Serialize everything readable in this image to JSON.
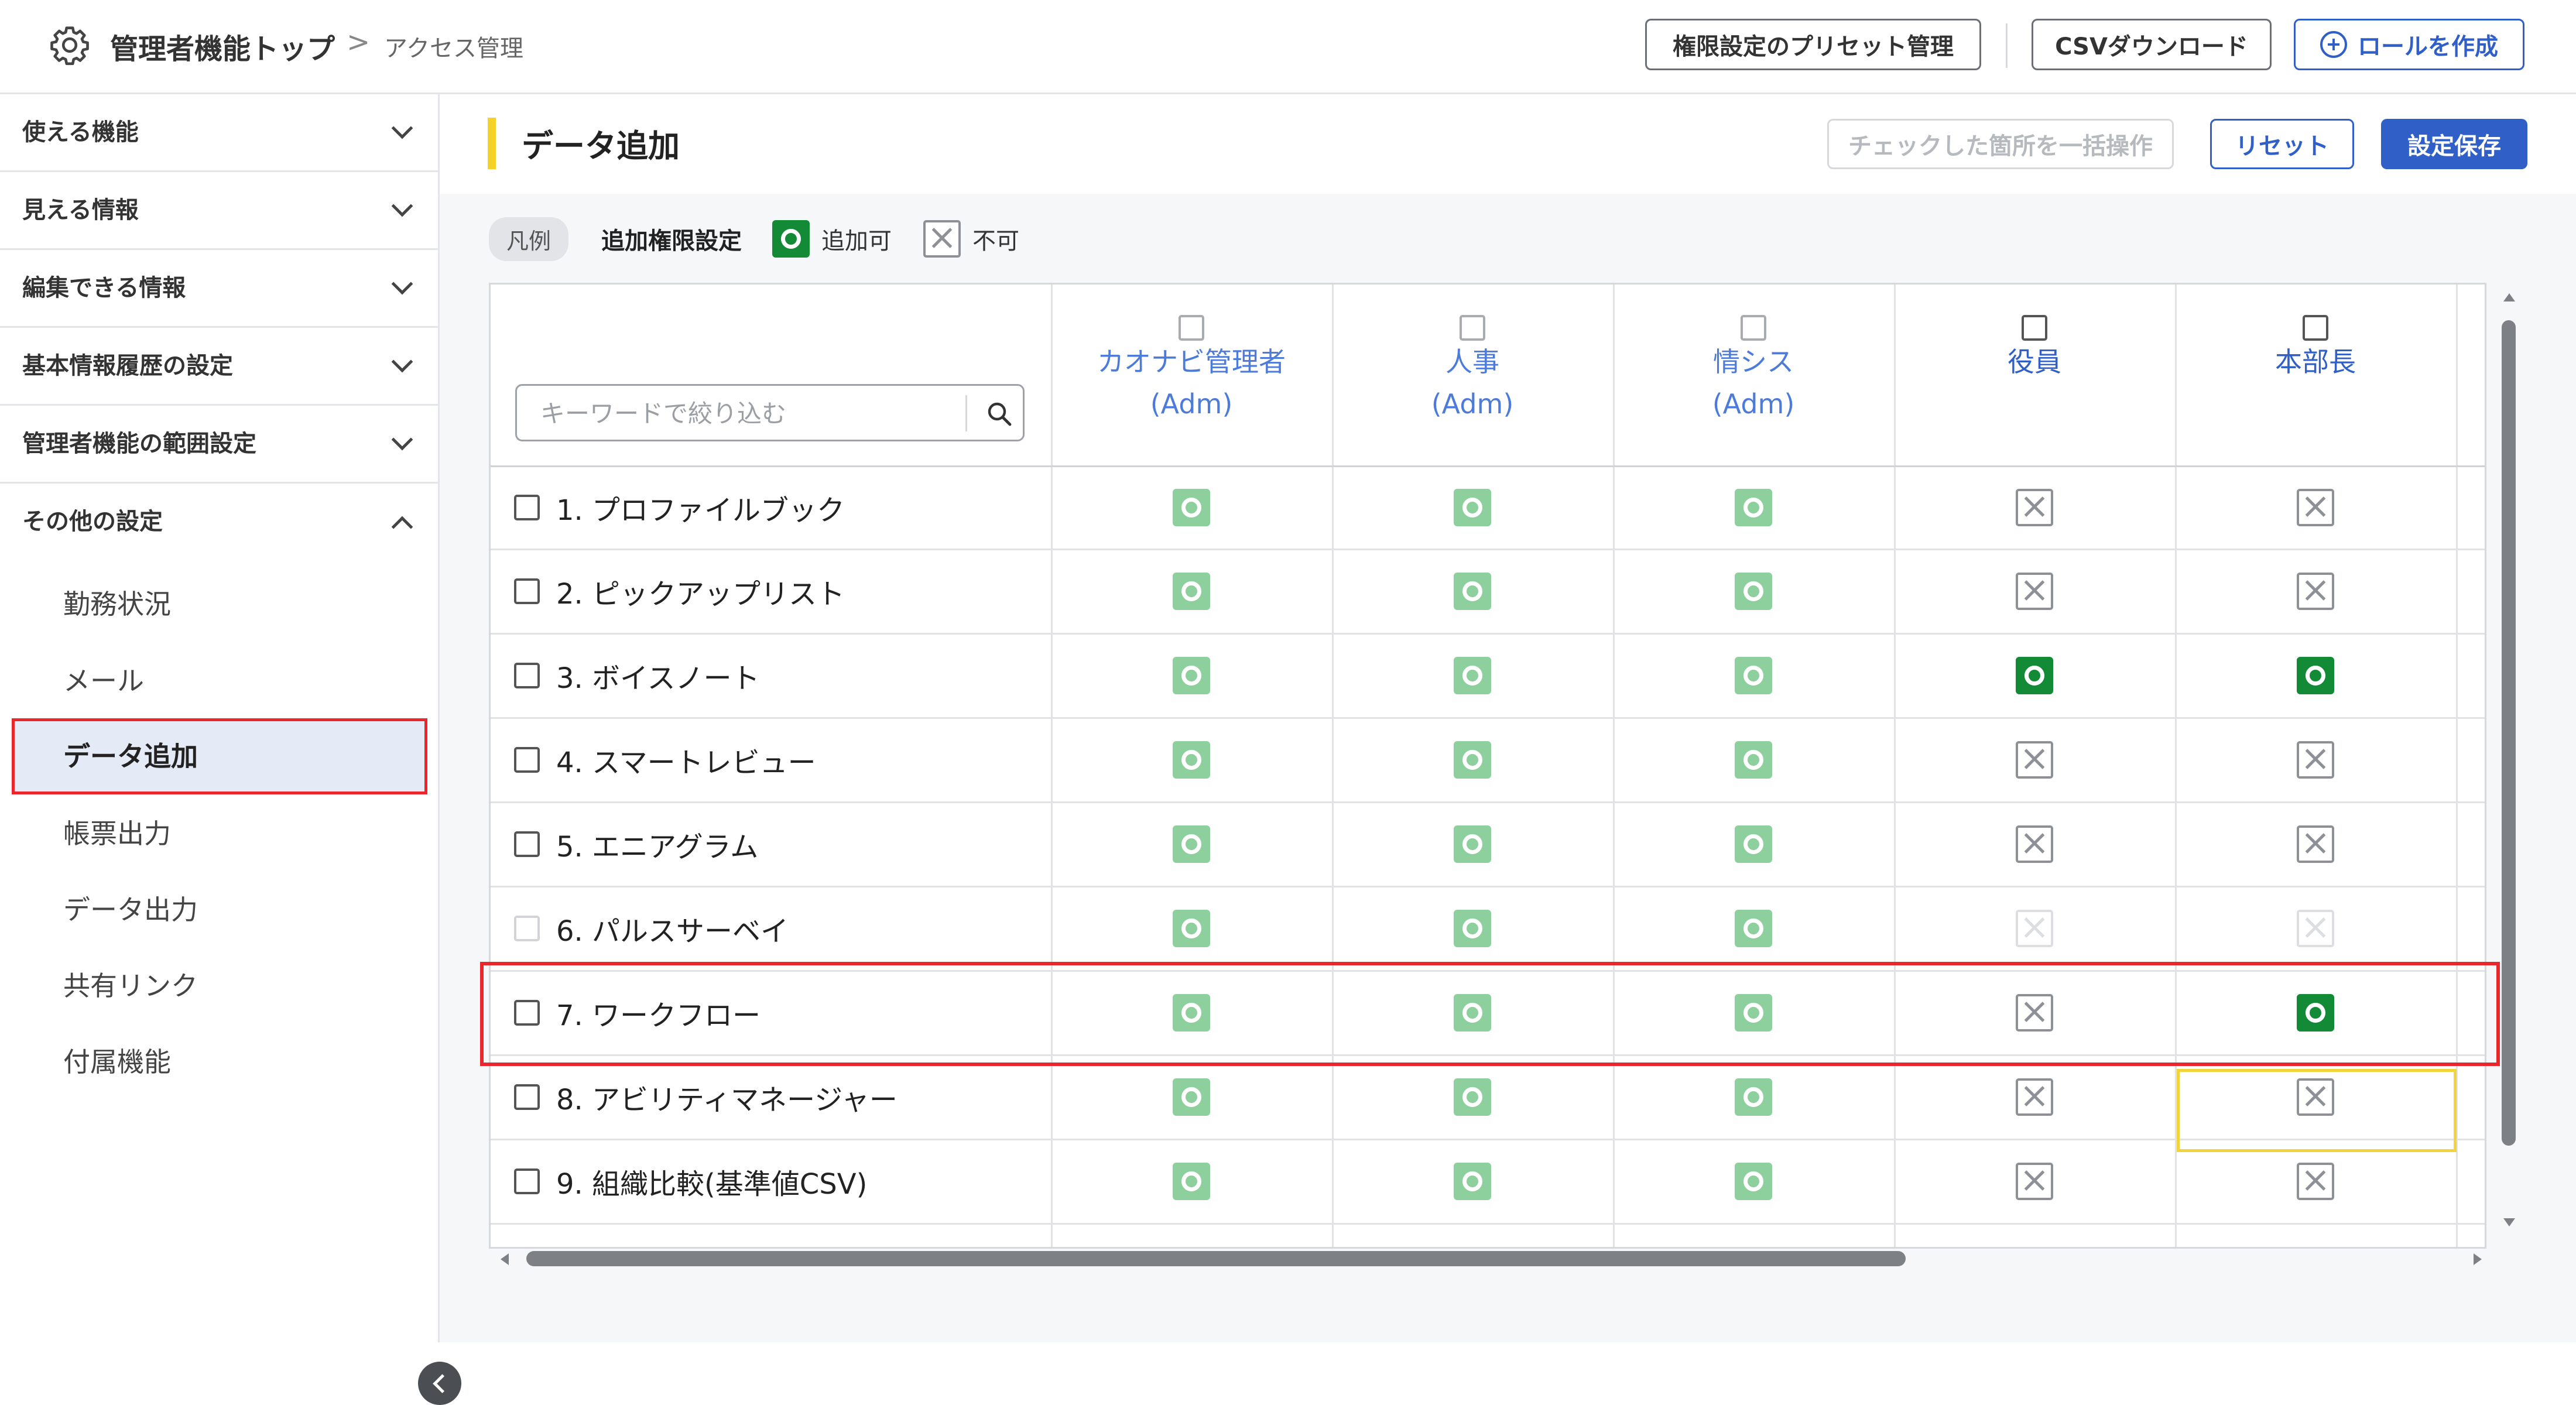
{
  "header": {
    "title": "管理者機能トップ",
    "separator": ">",
    "breadcrumb": "アクセス管理",
    "preset_button": "権限設定のプリセット管理",
    "csv_button": "CSVダウンロード",
    "role_button": "ロールを作成"
  },
  "sidebar": {
    "sections": [
      {
        "label": "使える機能",
        "expanded": false
      },
      {
        "label": "見える情報",
        "expanded": false
      },
      {
        "label": "編集できる情報",
        "expanded": false
      },
      {
        "label": "基本情報履歴の設定",
        "expanded": false
      },
      {
        "label": "管理者機能の範囲設定",
        "expanded": false
      },
      {
        "label": "その他の設定",
        "expanded": true
      }
    ],
    "sub_items": [
      "勤務状況",
      "メール",
      "データ追加",
      "帳票出力",
      "データ出力",
      "共有リンク",
      "付属機能"
    ],
    "active_item": "データ追加"
  },
  "main": {
    "title": "データ追加",
    "bulk_button": "チェックした箇所を一括操作",
    "reset_button": "リセット",
    "save_button": "設定保存"
  },
  "legend": {
    "pill": "凡例",
    "label": "追加権限設定",
    "allowed": "追加可",
    "denied": "不可"
  },
  "table": {
    "search_placeholder": "キーワードで絞り込む",
    "columns": [
      {
        "name": "カオナビ管理者",
        "sub": "(Adm)"
      },
      {
        "name": "人事",
        "sub": "(Adm)"
      },
      {
        "name": "情シス",
        "sub": "(Adm)"
      },
      {
        "name": "役員",
        "sub": ""
      },
      {
        "name": "本部長",
        "sub": ""
      }
    ],
    "rows": [
      {
        "label": "1. プロファイルブック",
        "cells": [
          "ok-light",
          "ok-light",
          "ok-light",
          "ng",
          "ng"
        ]
      },
      {
        "label": "2. ピックアップリスト",
        "cells": [
          "ok-light",
          "ok-light",
          "ok-light",
          "ng",
          "ng"
        ]
      },
      {
        "label": "3. ボイスノート",
        "cells": [
          "ok-light",
          "ok-light",
          "ok-light",
          "ok-dark",
          "ok-dark"
        ]
      },
      {
        "label": "4. スマートレビュー",
        "cells": [
          "ok-light",
          "ok-light",
          "ok-light",
          "ng",
          "ng"
        ]
      },
      {
        "label": "5. エニアグラム",
        "cells": [
          "ok-light",
          "ok-light",
          "ok-light",
          "ng",
          "ng"
        ]
      },
      {
        "label": "6. パルスサーベイ",
        "cells": [
          "ok-light",
          "ok-light",
          "ok-light",
          "ng-faint",
          "ng-faint"
        ]
      },
      {
        "label": "7. ワークフロー",
        "cells": [
          "ok-light",
          "ok-light",
          "ok-light",
          "ng",
          "ok-dark"
        ]
      },
      {
        "label": "8. アビリティマネージャー",
        "cells": [
          "ok-light",
          "ok-light",
          "ok-light",
          "ng",
          "ng"
        ]
      },
      {
        "label": "9. 組織比較(基準値CSV)",
        "cells": [
          "ok-light",
          "ok-light",
          "ok-light",
          "ng",
          "ng"
        ]
      }
    ]
  },
  "colors": {
    "accent_blue": "#2f5fc7",
    "allowed_green": "#138a36",
    "allowed_light_green": "#8ecf9e",
    "highlight_red": "#e8262c",
    "focus_yellow": "#f2d33a",
    "title_accent_yellow": "#f4d228"
  },
  "icons": {
    "settings": "gear-icon",
    "search": "search-icon",
    "create": "plus-circle-icon",
    "collapse": "chevron-left-icon"
  }
}
